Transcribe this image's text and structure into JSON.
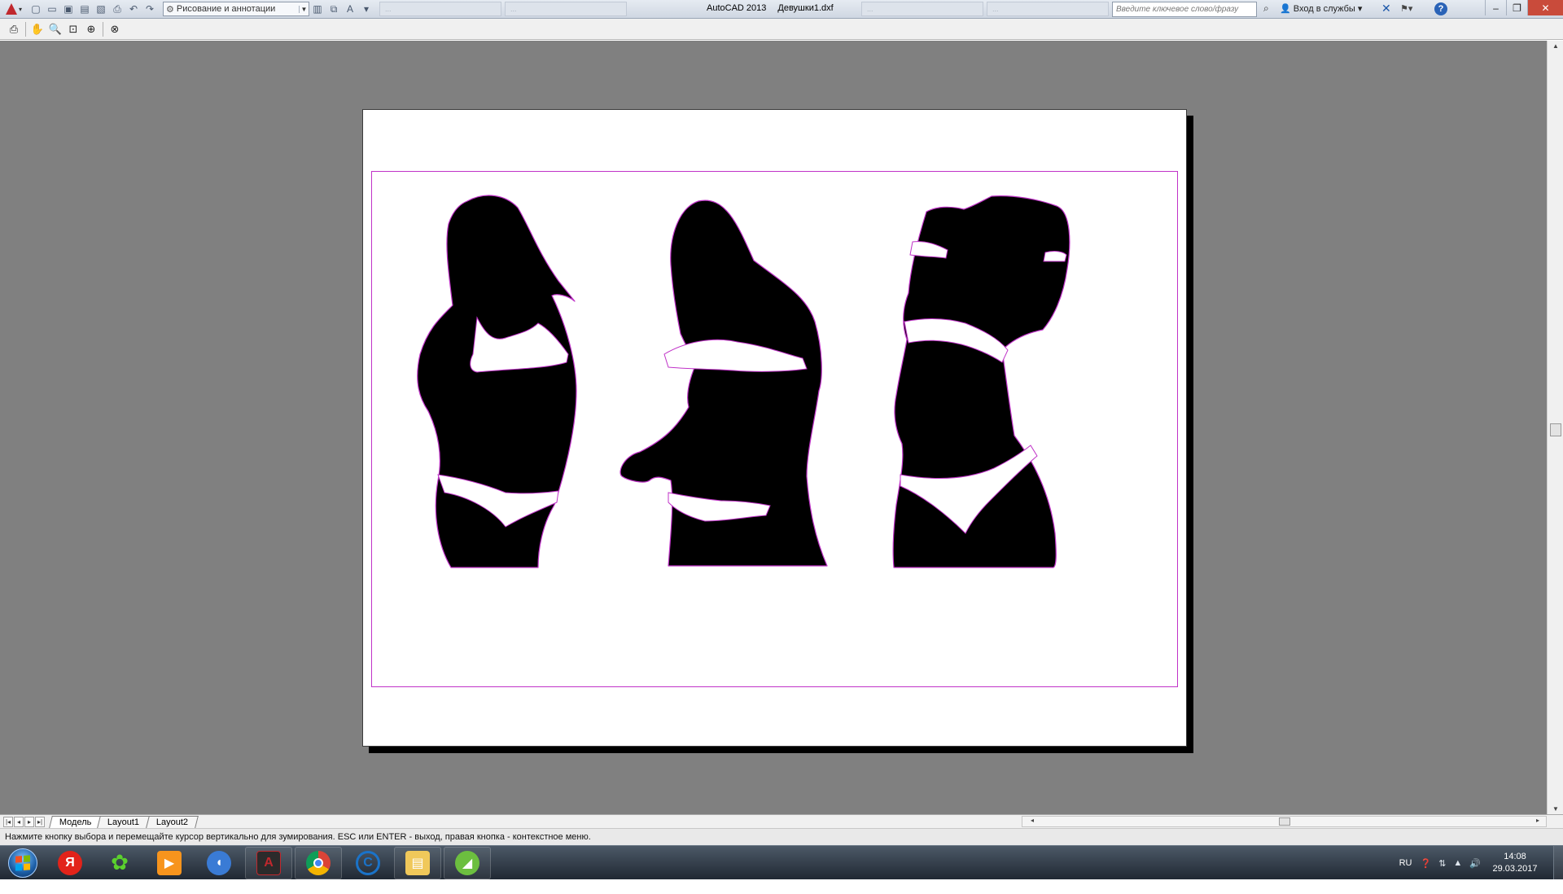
{
  "titlebar": {
    "workspace": "Рисование и аннотации",
    "background_tabs": [
      "...",
      "...",
      "...",
      "...",
      "..."
    ],
    "app_name": "AutoCAD 2013",
    "file_name": "Девушки1.dxf",
    "search_placeholder": "Введите ключевое слово/фразу",
    "login": "Вход в службы",
    "help_symbol": "?"
  },
  "layout_tabs": [
    {
      "label": "Модель",
      "active": true
    },
    {
      "label": "Layout1",
      "active": false
    },
    {
      "label": "Layout2",
      "active": false
    }
  ],
  "status": {
    "message": "Нажмите кнопку выбора и перемещайте курсор вертикально для зумирования. ESC или ENTER - выход, правая кнопка - контекстное меню."
  },
  "taskbar": {
    "items": [
      "windows-start",
      "yandex-browser",
      "icq",
      "media-player",
      "audio-app",
      "autocad",
      "google-chrome",
      "ccleaner",
      "file-explorer",
      "inkscape"
    ],
    "tray": {
      "language": "RU",
      "time": "14:08",
      "date": "29.03.2017"
    }
  },
  "colors": {
    "canvas_bg": "#808080",
    "paper": "#ffffff",
    "printable_border": "#c033c8",
    "silhouette": "#000000"
  }
}
